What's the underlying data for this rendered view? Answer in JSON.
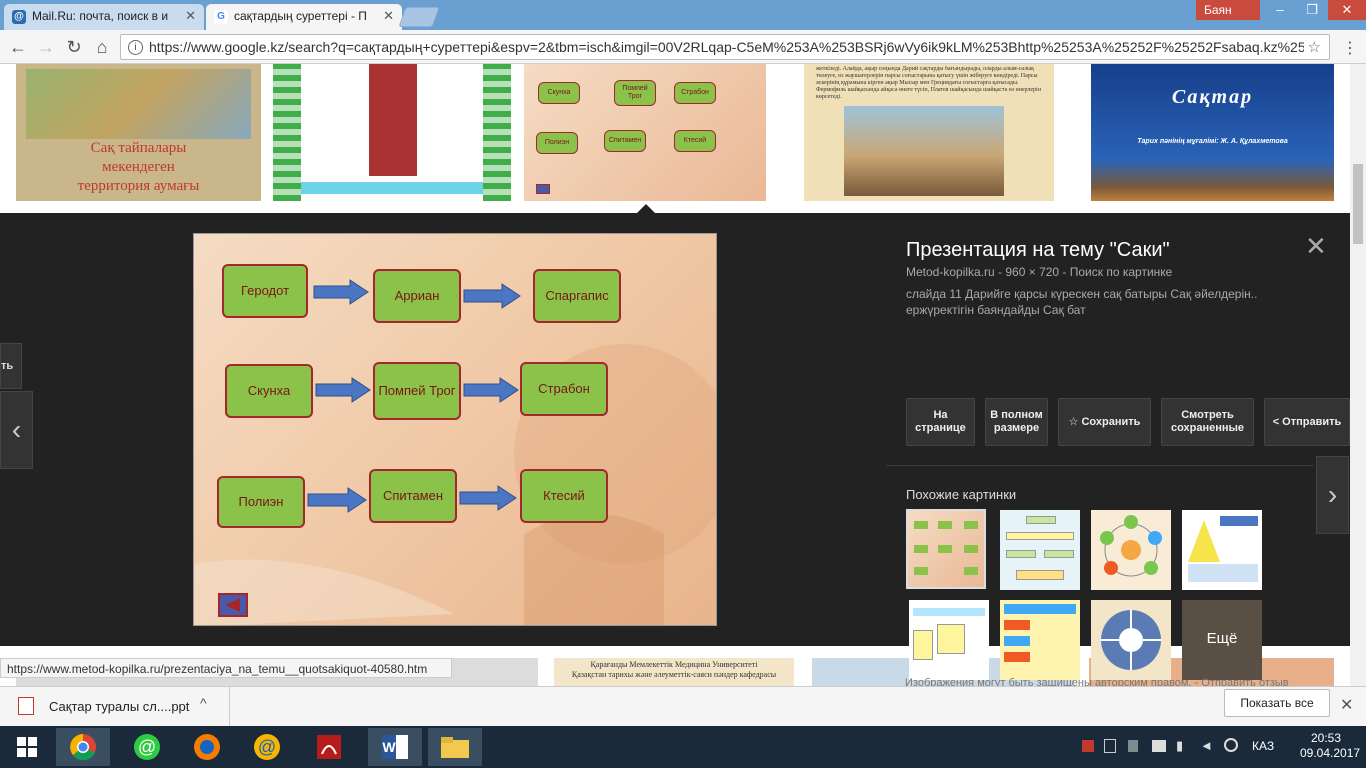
{
  "tabs": [
    {
      "title": "Mail.Ru: почта, поиск в и",
      "favicon": "@"
    },
    {
      "title": "сақтардың суреттері - П",
      "favicon": "G"
    }
  ],
  "window": {
    "user": "Баян"
  },
  "address": {
    "url": "https://www.google.kz/search?q=сақтардың+суреттері&espv=2&tbm=isch&imgil=00V2RLqap-C5eM%253A%253BSRj6wVy6ik9kLM%253Bhttp%25253A%25252F%25252Fsabaq.kz%2525"
  },
  "thumbs": {
    "map_caption": [
      "Сақ тайпалары",
      "мекендеген",
      "территория аумағы"
    ],
    "sak_title": "Сақтар",
    "sak_sub": "Тарих пәнінің мұғалімі: Ж. А. Құлахметова",
    "small_nodes": [
      "Скунха",
      "Помпей Трог",
      "Страбон",
      "Полиэн",
      "Спитамен",
      "Ктесий"
    ],
    "text_card": "жеткізеді. Алайда, ақыр соңында Дарий сақтарды бағындырады, оларды алым-салық төлеуге, өз жаушағерлерін парсы соғыстарына қатысу үшін жіберуге көндіреді. Парсы әскерінің құрамына кірген ақыр Мысыр мен Грециядағы соғыстарға қатысады. Фермофиль шайқасында айқаса өнеге түсіп, Платея шайқасында шайқаста өз өнерлерін көрсетеді."
  },
  "slide": {
    "row1": [
      "Геродот",
      "Арриан",
      "Спаргапис"
    ],
    "row2": [
      "Скунха",
      "Помпей Трог",
      "Страбон"
    ],
    "row3": [
      "Полиэн",
      "Спитамен",
      "Ктесий"
    ]
  },
  "side": {
    "title": "Презентация на тему \"Саки\"",
    "meta": "Metod-kopilka.ru  -  960 × 720  -  Поиск по картинке",
    "desc_line1": "слайда 11 Дарийге қарсы күрескен сақ батыры Сақ әйелдерін..",
    "desc_line2": "ержүректігін баяндайды Сақ бат",
    "btn_page": "На странице",
    "btn_full": "В полном размере",
    "btn_save": "Сохранить",
    "btn_saved": "Смотреть сохраненные",
    "btn_send": "Отправить",
    "similar": "Похожие картинки",
    "more": "Ещё",
    "copyright": "Изображения могут быть защищены авторским правом.",
    "feedback": "Отправить отзыв"
  },
  "left_partial_btn": "ть",
  "status": {
    "url": "https://www.metod-kopilka.ru/prezentaciya_na_temu__quotsakiquot-40580.htm"
  },
  "below_thumb_text": [
    "Қарағанды Мемлекеттік Медицина Университеті",
    "Қазақстан тарихы және әлеуметтік-саяси пәндер кафедрасы"
  ],
  "download": {
    "file": "Сақтар туралы сл....ppt",
    "show_all": "Показать все"
  },
  "taskbar": {
    "lang": "КАЗ",
    "time": "20:53",
    "date": "09.04.2017"
  },
  "colors": {
    "tabstrip": "#6a9fd1",
    "panel": "#222222",
    "slide_box": "#8bc34a",
    "slide_border": "#a3272b",
    "taskbar": "#1a2a3a"
  }
}
